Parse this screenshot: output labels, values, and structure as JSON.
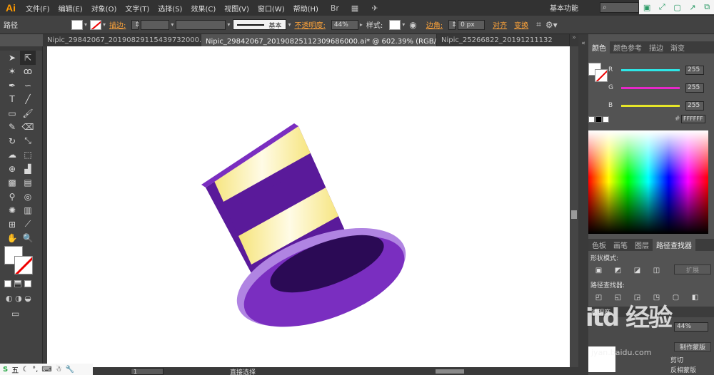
{
  "app": {
    "logo": "Ai",
    "menu": [
      "文件(F)",
      "编辑(E)",
      "对象(O)",
      "文字(T)",
      "选择(S)",
      "效果(C)",
      "视图(V)",
      "窗口(W)",
      "帮助(H)"
    ],
    "workspace": "基本功能",
    "search_placeholder": "⌕"
  },
  "control_bar": {
    "selection_label": "路径",
    "stroke_label": "描边:",
    "stroke_style": "基本",
    "opacity_label": "不透明度:",
    "opacity_value": "44%",
    "style_label": "样式:",
    "corner_label": "边角:",
    "corner_value": "0 px",
    "align_label": "对齐",
    "transform_label": "变换"
  },
  "documents": {
    "tabs": [
      {
        "label": "Nipic_29842067_20190829115439732000.ai*",
        "active": false
      },
      {
        "label": "Nipic_29842067_20190825112309686000.ai* @ 602.39% (RGB/预览)",
        "active": true
      },
      {
        "label": "Nipic_25266822_20191211132",
        "active": false
      }
    ]
  },
  "status_bar": {
    "zoom": "1",
    "tool": "直接选择"
  },
  "ime": {
    "brand": "S",
    "mode": "五"
  },
  "color_panel": {
    "tabs": [
      "颜色",
      "颜色参考",
      "描边",
      "渐变"
    ],
    "sliders": [
      {
        "label": "R",
        "value": "255",
        "color": "#2ee6e6"
      },
      {
        "label": "G",
        "value": "255",
        "color": "#e628c8"
      },
      {
        "label": "B",
        "value": "255",
        "color": "#e6e628"
      }
    ],
    "hex": "FFFFFF"
  },
  "pathfinder_panel": {
    "tabs": [
      "色板",
      "画笔",
      "图层",
      "路径查找器"
    ],
    "shape_modes_label": "形状模式:",
    "expand_label": "扩展",
    "pathfinders_label": "路径查找器:"
  },
  "transparency_panel": {
    "title": "透明度",
    "opacity": "44%",
    "mask_button": "制作蒙版",
    "clip_label": "剪切",
    "invert_label": "反相蒙版"
  },
  "watermark": {
    "text": "itd 经验",
    "sub": "jyan.baidu.com"
  },
  "colors": {
    "hat_purple": "#5a1a9a",
    "hat_yellow": "#f8ee8c",
    "brim_light": "#b084e2",
    "brim_dark": "#7a2ec0",
    "opening": "#2b0a55"
  }
}
